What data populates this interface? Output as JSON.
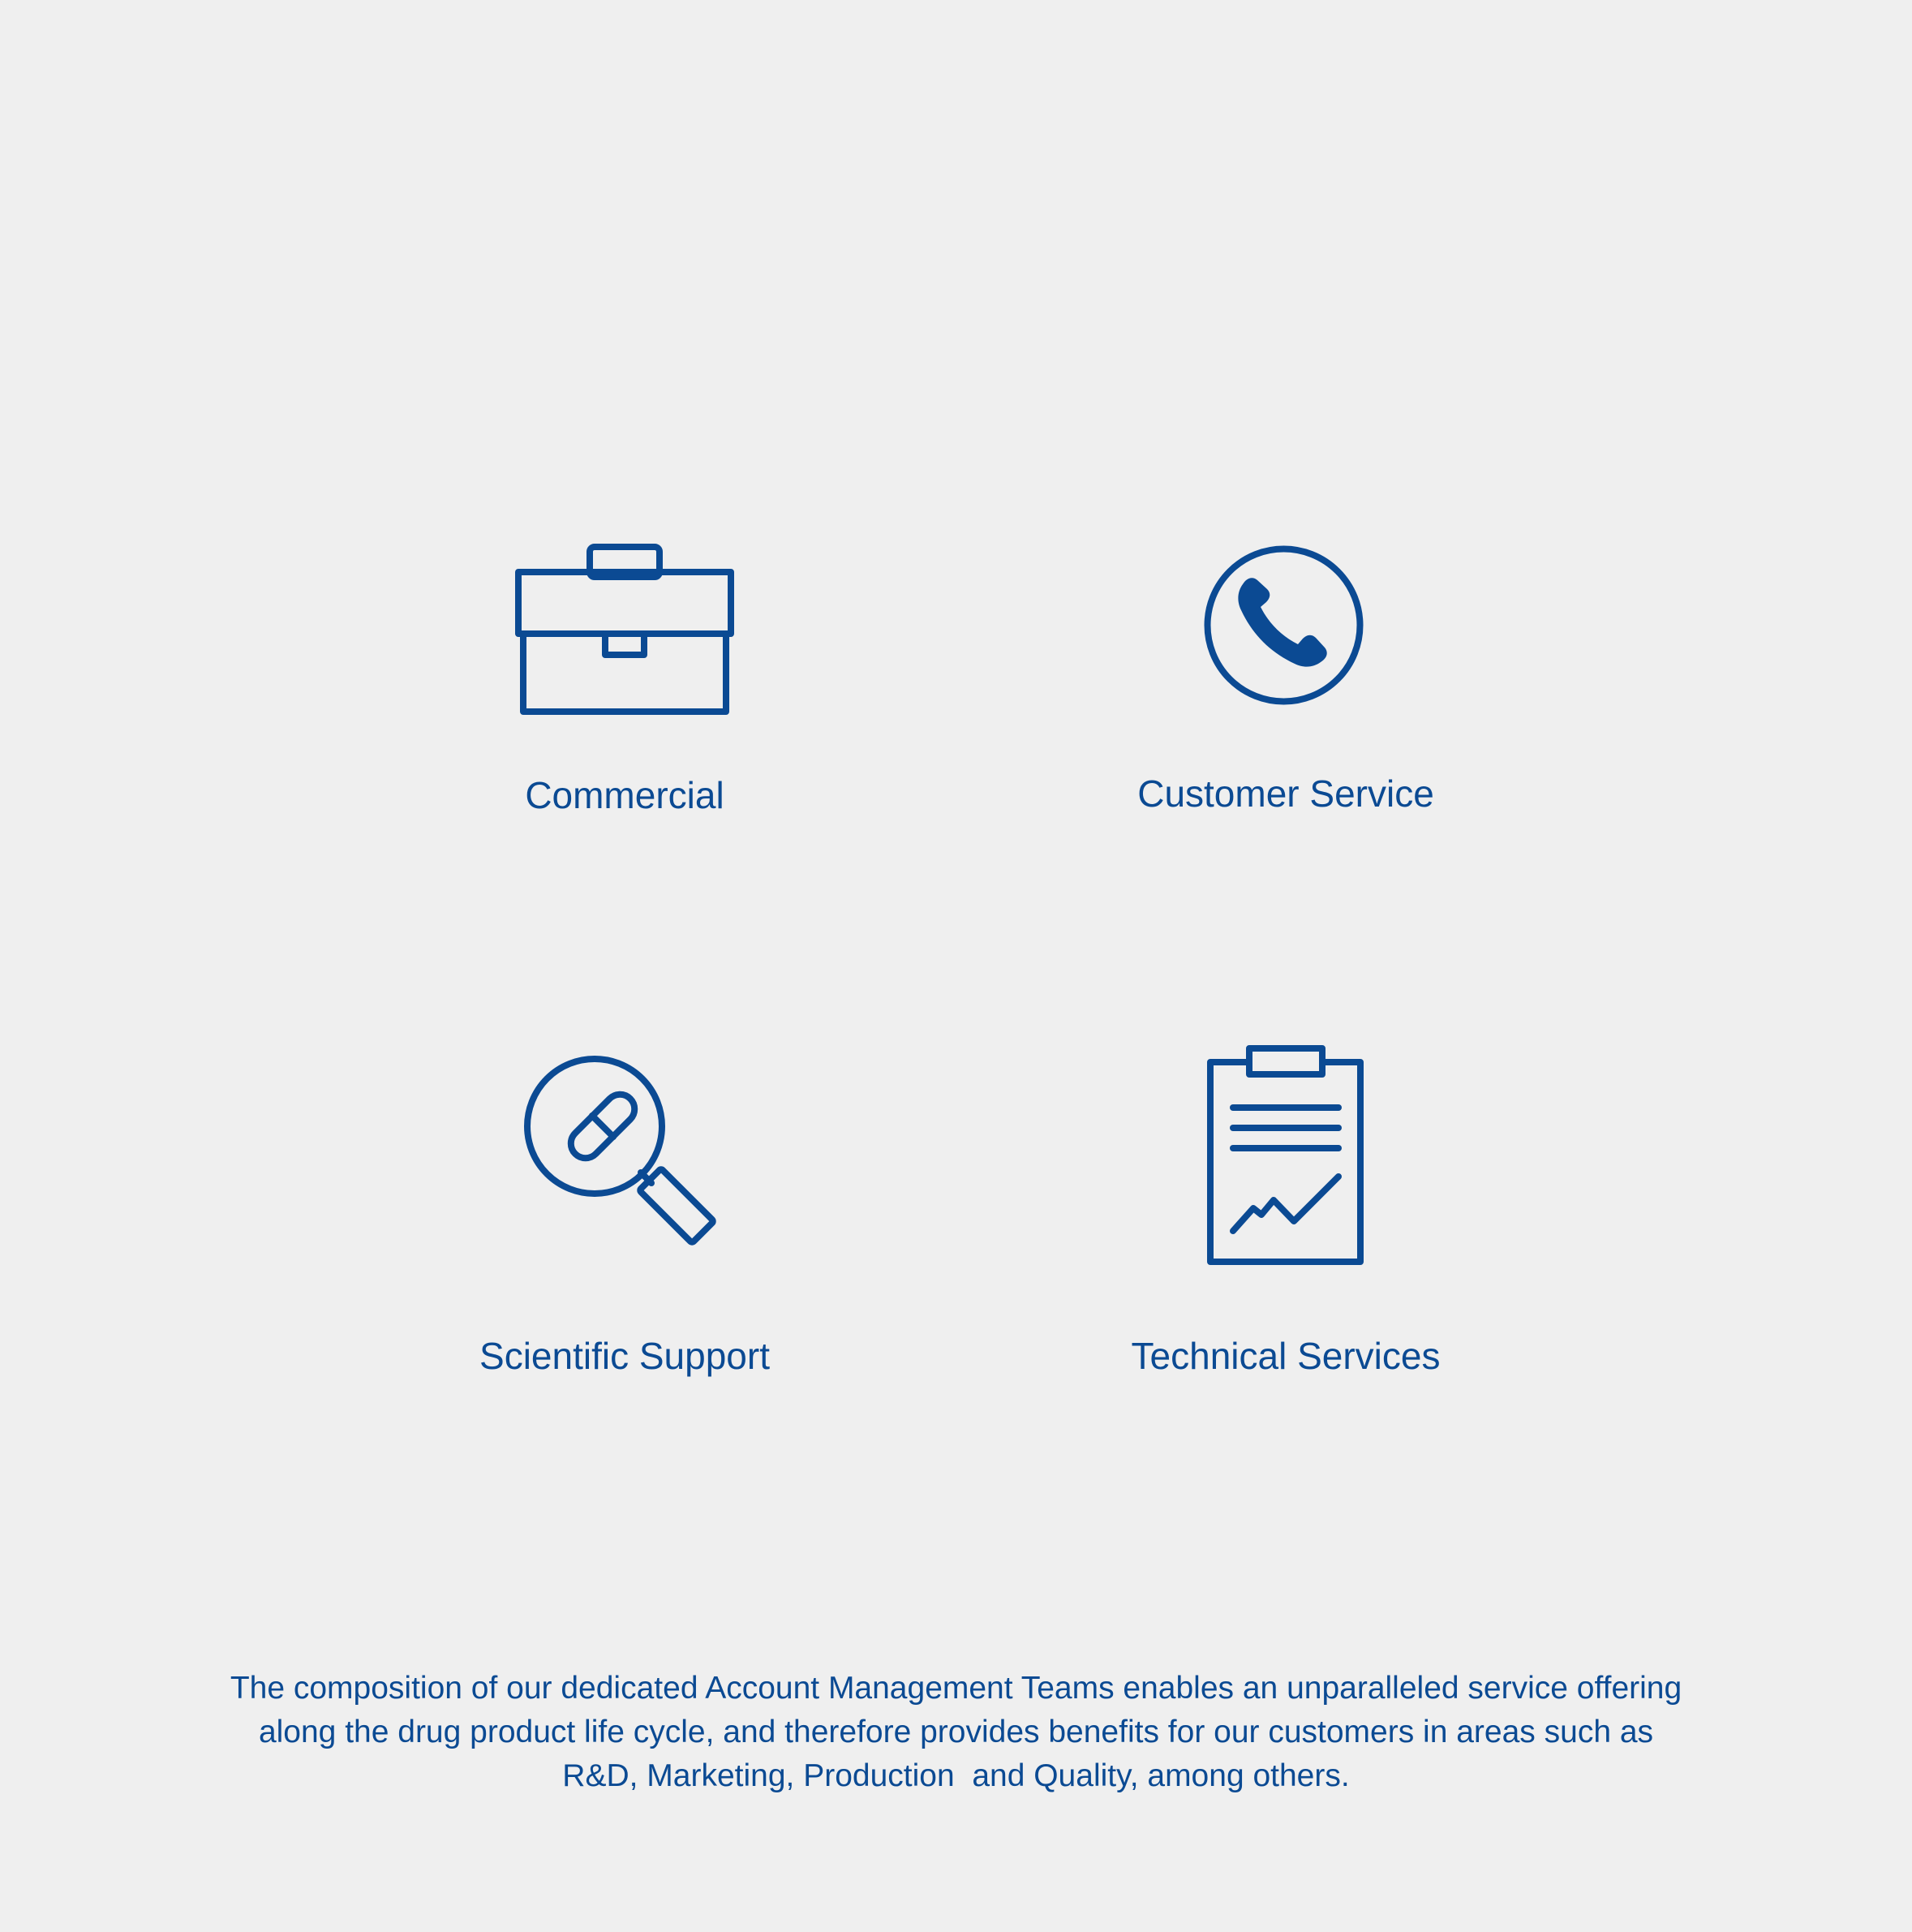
{
  "services": {
    "commercial": {
      "label": "Commercial",
      "icon": "briefcase-icon"
    },
    "customer_service": {
      "label": "Customer Service",
      "icon": "phone-icon"
    },
    "scientific_support": {
      "label": "Scientific Support",
      "icon": "magnifier-pill-icon"
    },
    "technical_services": {
      "label": "Technical Services",
      "icon": "clipboard-chart-icon"
    }
  },
  "description": {
    "line1": "The composition of our dedicated Account Management Teams enables an unparalleled service offering",
    "line2": "along the drug product life cycle, and therefore provides benefits for our customers in areas such as",
    "line3": "R&D, Marketing, Production  and Quality, among others."
  },
  "colors": {
    "background": "#efefef",
    "brand_blue": "#0b4a93"
  }
}
